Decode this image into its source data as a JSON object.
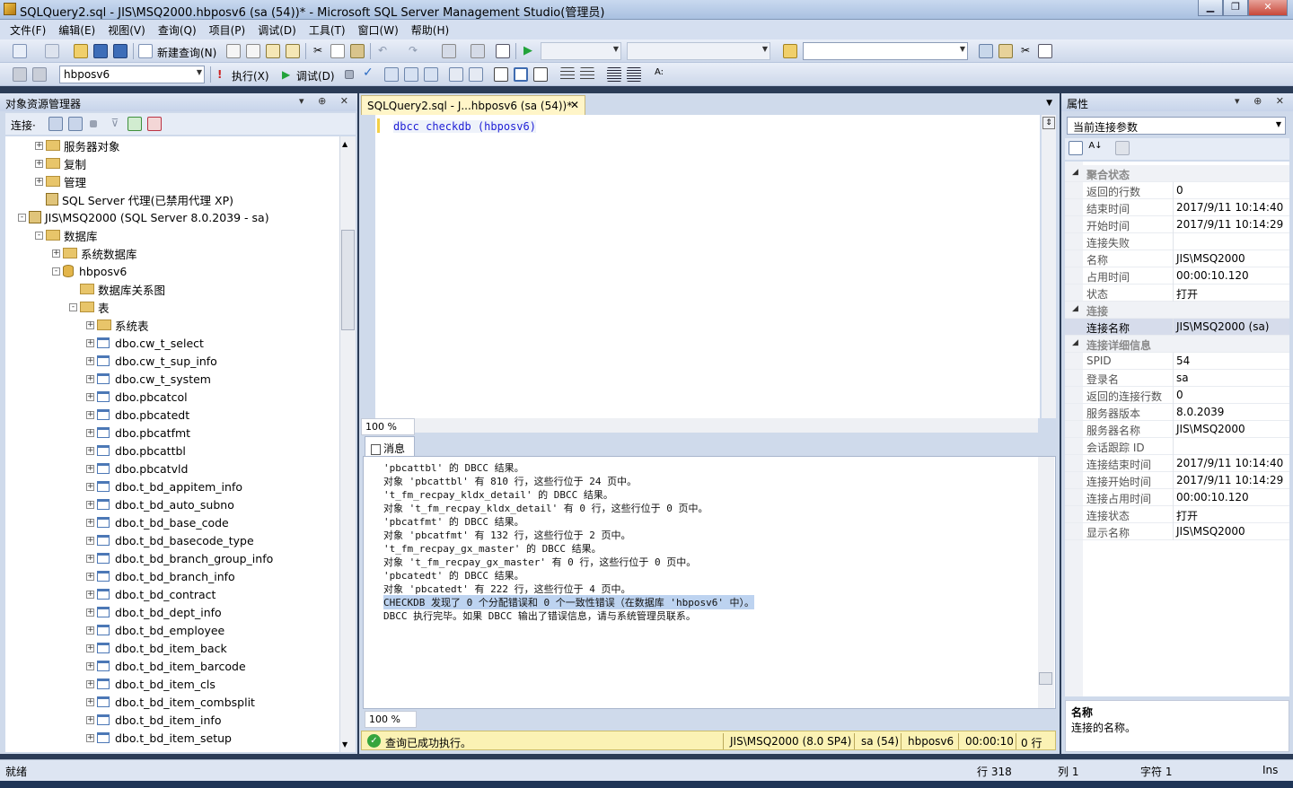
{
  "window": {
    "title": "SQLQuery2.sql - JIS\\MSQ2000.hbposv6 (sa (54))* - Microsoft SQL Server Management Studio(管理员)"
  },
  "menu": [
    "文件(F)",
    "编辑(E)",
    "视图(V)",
    "查询(Q)",
    "项目(P)",
    "调试(D)",
    "工具(T)",
    "窗口(W)",
    "帮助(H)"
  ],
  "toolbar1": {
    "new_query": "新建查询(N)"
  },
  "toolbar2": {
    "database": "hbposv6",
    "execute": "执行(X)",
    "debug": "调试(D)"
  },
  "object_explorer": {
    "title": "对象资源管理器",
    "connect_label": "连接·",
    "tree": [
      {
        "label": "服务器对象",
        "level": 1,
        "icon": "folder",
        "exp": "+"
      },
      {
        "label": "复制",
        "level": 1,
        "icon": "folder",
        "exp": "+"
      },
      {
        "label": "管理",
        "level": 1,
        "icon": "folder",
        "exp": "+"
      },
      {
        "label": "SQL Server 代理(已禁用代理 XP)",
        "level": 1,
        "icon": "agent",
        "exp": ""
      },
      {
        "label": "JIS\\MSQ2000 (SQL Server 8.0.2039 - sa)",
        "level": 0,
        "icon": "server",
        "exp": "-"
      },
      {
        "label": "数据库",
        "level": 1,
        "icon": "folder",
        "exp": "-"
      },
      {
        "label": "系统数据库",
        "level": 2,
        "icon": "folder",
        "exp": "+"
      },
      {
        "label": "hbposv6",
        "level": 2,
        "icon": "db",
        "exp": "-"
      },
      {
        "label": "数据库关系图",
        "level": 3,
        "icon": "folder",
        "exp": ""
      },
      {
        "label": "表",
        "level": 3,
        "icon": "folder",
        "exp": "-"
      },
      {
        "label": "系统表",
        "level": 4,
        "icon": "folder",
        "exp": "+"
      },
      {
        "label": "dbo.cw_t_select",
        "level": 4,
        "icon": "table",
        "exp": "+"
      },
      {
        "label": "dbo.cw_t_sup_info",
        "level": 4,
        "icon": "table",
        "exp": "+"
      },
      {
        "label": "dbo.cw_t_system",
        "level": 4,
        "icon": "table",
        "exp": "+"
      },
      {
        "label": "dbo.pbcatcol",
        "level": 4,
        "icon": "table",
        "exp": "+"
      },
      {
        "label": "dbo.pbcatedt",
        "level": 4,
        "icon": "table",
        "exp": "+"
      },
      {
        "label": "dbo.pbcatfmt",
        "level": 4,
        "icon": "table",
        "exp": "+"
      },
      {
        "label": "dbo.pbcattbl",
        "level": 4,
        "icon": "table",
        "exp": "+"
      },
      {
        "label": "dbo.pbcatvld",
        "level": 4,
        "icon": "table",
        "exp": "+"
      },
      {
        "label": "dbo.t_bd_appitem_info",
        "level": 4,
        "icon": "table",
        "exp": "+"
      },
      {
        "label": "dbo.t_bd_auto_subno",
        "level": 4,
        "icon": "table",
        "exp": "+"
      },
      {
        "label": "dbo.t_bd_base_code",
        "level": 4,
        "icon": "table",
        "exp": "+"
      },
      {
        "label": "dbo.t_bd_basecode_type",
        "level": 4,
        "icon": "table",
        "exp": "+"
      },
      {
        "label": "dbo.t_bd_branch_group_info",
        "level": 4,
        "icon": "table",
        "exp": "+"
      },
      {
        "label": "dbo.t_bd_branch_info",
        "level": 4,
        "icon": "table",
        "exp": "+"
      },
      {
        "label": "dbo.t_bd_contract",
        "level": 4,
        "icon": "table",
        "exp": "+"
      },
      {
        "label": "dbo.t_bd_dept_info",
        "level": 4,
        "icon": "table",
        "exp": "+"
      },
      {
        "label": "dbo.t_bd_employee",
        "level": 4,
        "icon": "table",
        "exp": "+"
      },
      {
        "label": "dbo.t_bd_item_back",
        "level": 4,
        "icon": "table",
        "exp": "+"
      },
      {
        "label": "dbo.t_bd_item_barcode",
        "level": 4,
        "icon": "table",
        "exp": "+"
      },
      {
        "label": "dbo.t_bd_item_cls",
        "level": 4,
        "icon": "table",
        "exp": "+"
      },
      {
        "label": "dbo.t_bd_item_combsplit",
        "level": 4,
        "icon": "table",
        "exp": "+"
      },
      {
        "label": "dbo.t_bd_item_info",
        "level": 4,
        "icon": "table",
        "exp": "+"
      },
      {
        "label": "dbo.t_bd_item_setup",
        "level": 4,
        "icon": "table",
        "exp": "+"
      }
    ]
  },
  "editor": {
    "tab_label": "SQLQuery2.sql - J...hbposv6 (sa (54))*",
    "code": "dbcc checkdb (hbposv6)",
    "zoom_top": "100 %",
    "zoom_bottom": "100 %",
    "messages_tab": "消息",
    "messages": [
      {
        "text": "'pbcattbl' 的 DBCC 结果。",
        "sel": false
      },
      {
        "text": "对象 'pbcattbl' 有 810 行，这些行位于 24 页中。",
        "sel": false
      },
      {
        "text": "'t_fm_recpay_kldx_detail' 的 DBCC 结果。",
        "sel": false
      },
      {
        "text": "对象 't_fm_recpay_kldx_detail' 有 0 行，这些行位于 0 页中。",
        "sel": false
      },
      {
        "text": "'pbcatfmt' 的 DBCC 结果。",
        "sel": false
      },
      {
        "text": "对象 'pbcatfmt' 有 132 行，这些行位于 2 页中。",
        "sel": false
      },
      {
        "text": "'t_fm_recpay_gx_master' 的 DBCC 结果。",
        "sel": false
      },
      {
        "text": "对象 't_fm_recpay_gx_master' 有 0 行，这些行位于 0 页中。",
        "sel": false
      },
      {
        "text": "'pbcatedt' 的 DBCC 结果。",
        "sel": false
      },
      {
        "text": "对象 'pbcatedt' 有 222 行，这些行位于 4 页中。",
        "sel": false
      },
      {
        "text": "CHECKDB 发现了 0 个分配错误和 0 个一致性错误（在数据库 'hbposv6' 中）。",
        "sel": true
      },
      {
        "text": "DBCC 执行完毕。如果 DBCC 输出了错误信息，请与系统管理员联系。",
        "sel": false
      }
    ],
    "status": {
      "message": "查询已成功执行。",
      "server": "JIS\\MSQ2000 (8.0 SP4)",
      "user": "sa (54)",
      "db": "hbposv6",
      "elapsed": "00:00:10",
      "rows": "0 行"
    }
  },
  "properties": {
    "title": "属性",
    "selector": "当前连接参数",
    "rows": [
      {
        "k": "聚合状态",
        "v": "",
        "cat": true
      },
      {
        "k": "返回的行数",
        "v": "0"
      },
      {
        "k": "结束时间",
        "v": "2017/9/11 10:14:40"
      },
      {
        "k": "开始时间",
        "v": "2017/9/11 10:14:29"
      },
      {
        "k": "连接失败",
        "v": ""
      },
      {
        "k": "名称",
        "v": "JIS\\MSQ2000"
      },
      {
        "k": "占用时间",
        "v": "00:00:10.120"
      },
      {
        "k": "状态",
        "v": "打开"
      },
      {
        "k": "连接",
        "v": "",
        "cat": true
      },
      {
        "k": "连接名称",
        "v": "JIS\\MSQ2000 (sa)",
        "sel": true
      },
      {
        "k": "连接详细信息",
        "v": "",
        "cat": true
      },
      {
        "k": "SPID",
        "v": "54"
      },
      {
        "k": "登录名",
        "v": "sa"
      },
      {
        "k": "返回的连接行数",
        "v": "0"
      },
      {
        "k": "服务器版本",
        "v": "8.0.2039"
      },
      {
        "k": "服务器名称",
        "v": "JIS\\MSQ2000"
      },
      {
        "k": "会话跟踪 ID",
        "v": ""
      },
      {
        "k": "连接结束时间",
        "v": "2017/9/11 10:14:40"
      },
      {
        "k": "连接开始时间",
        "v": "2017/9/11 10:14:29"
      },
      {
        "k": "连接占用时间",
        "v": "00:00:10.120"
      },
      {
        "k": "连接状态",
        "v": "打开"
      },
      {
        "k": "显示名称",
        "v": "JIS\\MSQ2000"
      }
    ],
    "desc_title": "名称",
    "desc_text": "连接的名称。"
  },
  "statusbar": {
    "ready": "就绪",
    "line": "行 318",
    "col": "列 1",
    "ch": "字符 1",
    "ins": "Ins"
  }
}
